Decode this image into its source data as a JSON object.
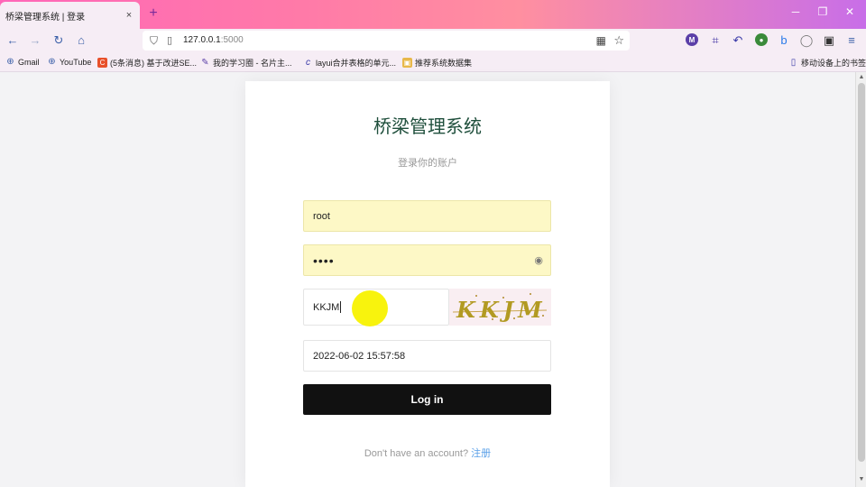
{
  "browser": {
    "tab_title": "桥梁管理系统 | 登录",
    "tab_close": "×",
    "new_tab": "+",
    "url_host": "127.0.0.1",
    "url_port": ":5000",
    "bookmarks": [
      {
        "label": "Gmail"
      },
      {
        "label": "YouTube"
      },
      {
        "label": "(5条消息) 基于改进SE..."
      },
      {
        "label": "我的学习圈 - 名片主..."
      },
      {
        "label": "layui合并表格的单元..."
      },
      {
        "label": "推荐系统数据集"
      }
    ],
    "mobile_bookmarks": "移动设备上的书签"
  },
  "login": {
    "app_title": "桥梁管理系统",
    "subtitle": "登录你的账户",
    "username_value": "root",
    "password_mask": "••••",
    "captcha_value": "KKJM",
    "captcha_image_text": "KKJM",
    "datetime_value": "2022-06-02 15:57:58",
    "login_label": "Log in",
    "signup_prompt": "Don't have an account?",
    "signup_link": "注册"
  },
  "colors": {
    "accent": "#1f4f3c",
    "button": "#111111",
    "autofill": "#fdf8c6",
    "link": "#5aa0e8",
    "titlebar_gradient": [
      "#ff66b8",
      "#c86ee8"
    ]
  }
}
